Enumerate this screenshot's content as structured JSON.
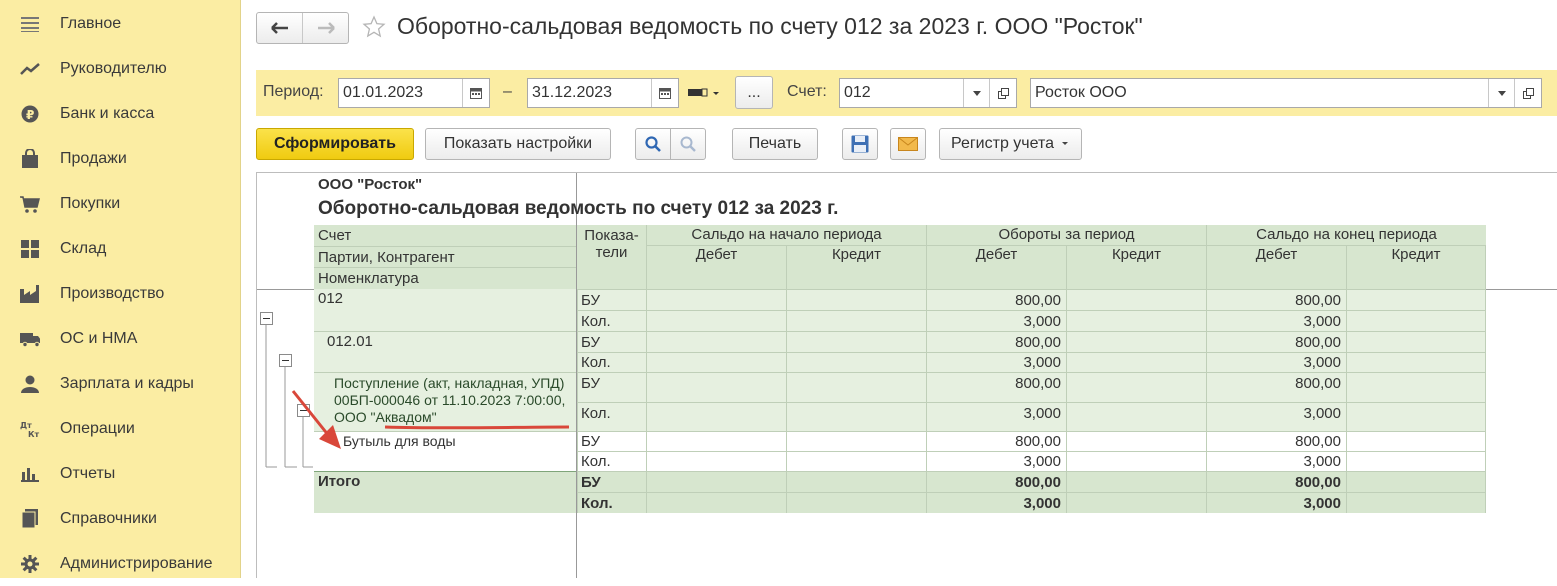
{
  "sidebar": {
    "items": [
      {
        "label": "Главное",
        "icon": "menu-lines-icon"
      },
      {
        "label": "Руководителю",
        "icon": "trend-chart-icon"
      },
      {
        "label": "Банк и касса",
        "icon": "ruble-coin-icon"
      },
      {
        "label": "Продажи",
        "icon": "shopping-bag-icon"
      },
      {
        "label": "Покупки",
        "icon": "cart-icon"
      },
      {
        "label": "Склад",
        "icon": "warehouse-icon"
      },
      {
        "label": "Производство",
        "icon": "factory-icon"
      },
      {
        "label": "ОС и НМА",
        "icon": "truck-icon"
      },
      {
        "label": "Зарплата и кадры",
        "icon": "person-icon"
      },
      {
        "label": "Операции",
        "icon": "debit-credit-icon"
      },
      {
        "label": "Отчеты",
        "icon": "bar-chart-icon"
      },
      {
        "label": "Справочники",
        "icon": "books-icon"
      },
      {
        "label": "Администрирование",
        "icon": "gear-icon"
      }
    ]
  },
  "header": {
    "title": "Оборотно-сальдовая ведомость по счету 012 за 2023 г. ООО \"Росток\""
  },
  "filters": {
    "period_label": "Период:",
    "date_from": "01.01.2023",
    "dash": "–",
    "date_to": "31.12.2023",
    "more_label": "...",
    "account_label": "Счет:",
    "account_value": "012",
    "org_value": "Росток ООО"
  },
  "toolbar": {
    "generate_label": "Сформировать",
    "settings_label": "Показать настройки",
    "print_label": "Печать",
    "register_label": "Регистр учета"
  },
  "report": {
    "org": "ООО \"Росток\"",
    "title": "Оборотно-сальдовая ведомость по счету 012 за 2023 г.",
    "row_headers": [
      "Счет",
      "Партии, Контрагент",
      "Номенклатура"
    ],
    "indicator_header": "Показа-\nтели",
    "groups": [
      "Сальдо на начало периода",
      "Обороты за период",
      "Сальдо на конец периода"
    ],
    "debit": "Дебет",
    "credit": "Кредит",
    "rows": [
      {
        "name": "012",
        "ind": "БУ",
        "turn_debit": "800,00",
        "end_debit": "800,00"
      },
      {
        "name": "",
        "ind": "Кол.",
        "turn_debit": "3,000",
        "end_debit": "3,000"
      },
      {
        "name": "012.01",
        "ind": "БУ",
        "turn_debit": "800,00",
        "end_debit": "800,00"
      },
      {
        "name": "",
        "ind": "Кол.",
        "turn_debit": "3,000",
        "end_debit": "3,000"
      },
      {
        "name": "Поступление (акт, накладная, УПД) 00БП-000046 от 11.10.2023 7:00:00, ООО \"Аквадом\"",
        "ind": "БУ",
        "turn_debit": "800,00",
        "end_debit": "800,00"
      },
      {
        "name": "",
        "ind": "Кол.",
        "turn_debit": "3,000",
        "end_debit": "3,000"
      },
      {
        "name": "Бутыль для воды",
        "ind": "БУ",
        "turn_debit": "800,00",
        "end_debit": "800,00"
      },
      {
        "name": "",
        "ind": "Кол.",
        "turn_debit": "3,000",
        "end_debit": "3,000"
      }
    ],
    "total": {
      "name": "Итого",
      "rows": [
        {
          "ind": "БУ",
          "turn_debit": "800,00",
          "end_debit": "800,00"
        },
        {
          "ind": "Кол.",
          "turn_debit": "3,000",
          "end_debit": "3,000"
        }
      ]
    }
  },
  "colors": {
    "sidebar": "#fbeda3",
    "primary_button": "#f3d21c",
    "report_green": "#e6f0e0",
    "annotation_red": "#d9473a"
  }
}
